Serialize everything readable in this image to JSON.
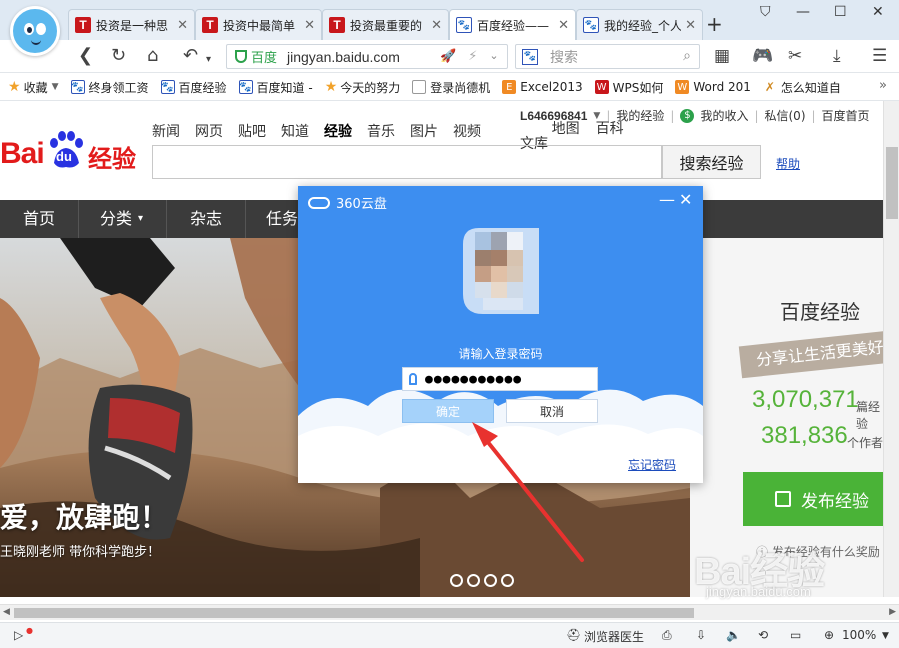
{
  "tabs": [
    {
      "title": "投资是一种思",
      "icon": "T"
    },
    {
      "title": "投资中最简单",
      "icon": "T"
    },
    {
      "title": "投资最重要的",
      "icon": "T"
    },
    {
      "title": "百度经验——",
      "icon": "paw"
    },
    {
      "title": "我的经验_个人",
      "icon": "paw"
    }
  ],
  "addressbar": {
    "site_label": "百度",
    "url": "jingyan.baidu.com",
    "search_placeholder": "搜索"
  },
  "bookmarks": [
    {
      "label": "收藏",
      "icon": "star",
      "caret": true
    },
    {
      "label": "终身领工资",
      "icon": "paw"
    },
    {
      "label": "百度经验",
      "icon": "paw"
    },
    {
      "label": "百度知道 -",
      "icon": "paw"
    },
    {
      "label": "今天的努力",
      "icon": "star"
    },
    {
      "label": "登录尚德机",
      "icon": "doc"
    },
    {
      "label": "Excel2013",
      "icon": "excel"
    },
    {
      "label": "WPS如何",
      "icon": "wps"
    },
    {
      "label": "Word 201",
      "icon": "word"
    },
    {
      "label": "怎么知道自",
      "icon": "tool"
    }
  ],
  "page": {
    "logo_bai": "Bai",
    "logo_du": "du",
    "logo_jy": "经验",
    "topnav": [
      "新闻",
      "网页",
      "贴吧",
      "知道",
      "经验",
      "音乐",
      "图片",
      "视频"
    ],
    "topnav2": [
      "地图",
      "百科",
      "文库"
    ],
    "user": {
      "name": "L646696841",
      "my_exp": "我的经验",
      "my_income": "我的收入",
      "message": "私信(0)",
      "home": "百度首页"
    },
    "search_button": "搜索经验",
    "help": "帮助",
    "mainnav": [
      "首页",
      "分类",
      "杂志",
      "任务"
    ],
    "hero": {
      "slogan": "爱，放肆跑！",
      "sub": "王晓刚老师 带你科学跑步！"
    },
    "side": {
      "title": "百度经验",
      "ribbon": "分享让生活更美好",
      "count1": "3,070,371",
      "count1_suffix": "篇经验",
      "count2": "381,836",
      "count2_suffix": "个作者",
      "publish": "发布经验",
      "why": "发布经验有什么奖励"
    }
  },
  "watermark": {
    "brand": "Bai经验",
    "url": "jingyan.baidu.com"
  },
  "dialog": {
    "title": "360云盘",
    "prompt": "请输入登录密码",
    "password": "●●●●●●●●●●●",
    "ok": "确定",
    "cancel": "取消",
    "forgot": "忘记密码"
  },
  "statusbar": {
    "doctor": "浏览器医生",
    "zoom": "100%"
  },
  "colors": {
    "dialog_blue": "#3d8ef0",
    "baidu_red": "#e21b1b",
    "exp_green": "#4ab337",
    "arrow_red": "#e8322f"
  }
}
